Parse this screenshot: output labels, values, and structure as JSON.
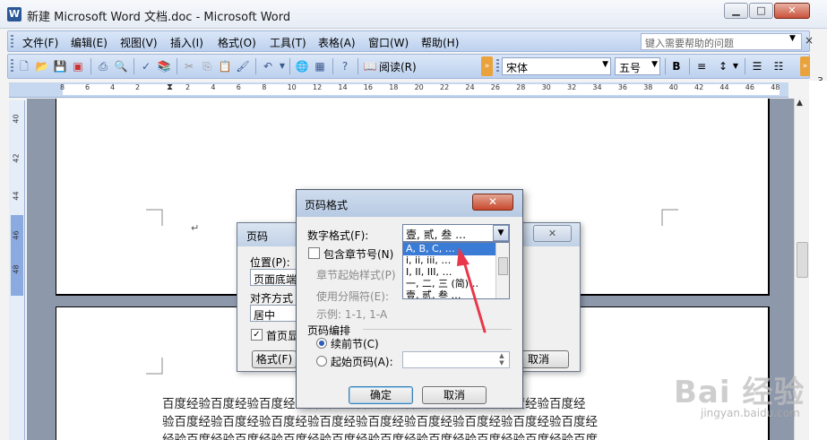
{
  "window": {
    "title": "新建 Microsoft Word 文档.doc - Microsoft Word",
    "min_label": "▁",
    "max_label": "□",
    "close_label": "✕"
  },
  "menu": {
    "items": [
      "文件(F)",
      "编辑(E)",
      "视图(V)",
      "插入(I)",
      "格式(O)",
      "工具(T)",
      "表格(A)",
      "窗口(W)",
      "帮助(H)"
    ],
    "help_placeholder": "键入需要帮助的问题",
    "close_doc": "×"
  },
  "toolbar": {
    "read_label": "阅读(R)",
    "font": "宋体",
    "size": "五号",
    "bold": "B",
    "side_text": "3."
  },
  "ruler": {
    "ticks": [
      "8",
      "6",
      "4",
      "2",
      "2",
      "4",
      "6",
      "8",
      "10",
      "12",
      "14",
      "16",
      "18",
      "20",
      "22",
      "24",
      "26",
      "28",
      "30",
      "32",
      "34",
      "36",
      "38",
      "40",
      "42",
      "44",
      "46",
      "48"
    ],
    "vticks": [
      "40",
      "42",
      "44",
      "46",
      "48"
    ]
  },
  "document": {
    "text_lines": [
      "百度经验百度经验百度经验百度经验百度经验百度经验百度经验百度经验百度经",
      "验百度经验百度经验百度经验百度经验百度经验百度经验百度经验百度经验百度经",
      "经验百度经验百度经验百度经验百度经验百度经验百度经验百度经验百度经验百度"
    ],
    "enter_mark": "↵"
  },
  "dialog_page_numbers": {
    "title": "页码",
    "position_label": "位置(P):",
    "position_value": "页面底端",
    "alignment_label": "对齐方式",
    "alignment_value": "居中",
    "first_page_label": "首页显",
    "format_button": "格式(F)",
    "cancel_button": "取消",
    "close_label": "✕"
  },
  "dialog_format": {
    "title": "页码格式",
    "close_label": "✕",
    "number_format_label": "数字格式(F):",
    "number_format_value": "壹, 贰, 叁 …",
    "options": [
      "A, B, C, …",
      "i, ii, iii, …",
      "I, II, III, …",
      "一, 二, 三 (简)…",
      "壹, 贰, 叁 …"
    ],
    "include_chapter_label": "包含章节号(N)",
    "chapter_style_label": "章节起始样式(P)",
    "separator_label": "使用分隔符(E):",
    "example_label": "示例:  1-1, 1-A",
    "numbering_group": "页码编排",
    "continue_label": "续前节(C)",
    "start_at_label": "起始页码(A):",
    "ok_button": "确定",
    "cancel_button": "取消"
  },
  "watermark": {
    "text": "Bai 经验",
    "url": "jingyan.baidu.com"
  },
  "colors": {
    "annotation_arrow": "#e8374a",
    "list_selection": "#3a7bd5",
    "close_button": "#c8482c"
  }
}
